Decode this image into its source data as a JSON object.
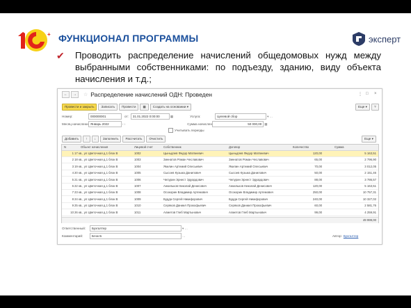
{
  "slide": {
    "title": "ФУНКЦИОНАЛ ПРОГРАММЫ",
    "logo_1c": "1С",
    "expert_brand": "эксперт",
    "bullet": "Проводить распределение начислений общедомовых нужд между выбранными собственниками: по подъезду, зданию, виду объекта начисления и т.д.;",
    "colors": {
      "title": "#1a4f9c",
      "logo_red": "#e2231a",
      "logo_yellow": "#f7d117",
      "check": "#c0242b"
    }
  },
  "window": {
    "title": "Распределение начислений ОДН: Проведен",
    "controls": [
      "⋮",
      "□",
      "×"
    ],
    "toolbar": {
      "post_close": "Провести и закрыть",
      "save": "Записать",
      "post": "Провести",
      "create_based": "Создать на основании",
      "more": "Еще",
      "help": "?"
    },
    "form": {
      "number_label": "Номер:",
      "number_value": "000000001",
      "from_label": "от:",
      "date_value": "31.01.2022 0:00:00",
      "service_label": "Услуга:",
      "service_value": "Целевой сбор",
      "month_label": "Месяц начисления:",
      "month_value": "Январь 2022",
      "amount_label": "Сумма начисления:",
      "amount_value": "50 000,00",
      "consider_periods": "Учитывать периоды"
    },
    "table_toolbar": {
      "add": "Добавить",
      "fill": "Заполнить",
      "distribute": "Рассчитать",
      "clear": "Очистить",
      "more": "Еще"
    },
    "table": {
      "columns": [
        "N",
        "Объект начисления",
        "Лицевой счет",
        "Собственник",
        "Договор",
        "Количество",
        "Сумма"
      ],
      "rows": [
        [
          "1",
          "17 кв., ул Цветочная д.1 блок В",
          "1002",
          "Цыньдяев Федор Матвеевич",
          "Цыньдяев Федор Матвеевич",
          "120,00",
          "5 163,51"
        ],
        [
          "2",
          "18 кв., ул Цветочная д.1 блок В",
          "1003",
          "Зиннатов Роман Чеславович",
          "Зиннатов Роман Чеславович",
          "65,00",
          "2 796,90"
        ],
        [
          "3",
          "19 кв., ул Цветочная д.1 блок В",
          "1004",
          "Якилин Артемий Олесьевич",
          "Якилин Артемий Олесьевич",
          "70,00",
          "3 012,05"
        ],
        [
          "4",
          "20 кв., ул Цветочная д.1 блок В",
          "1005",
          "Сысоев Кузьма Данилович",
          "Сысоев Кузьма Данилович",
          "50,00",
          "2 151,46"
        ],
        [
          "5",
          "21 кв., ул Цветочная д.1 блок В",
          "1006",
          "Чепурин Эрнест Эдуардович",
          "Чепурин Эрнест Эдуардович",
          "88,00",
          "3 786,57"
        ],
        [
          "6",
          "22 кв., ул Цветочная д.1 блок В",
          "1007",
          "Анкильков Николай Денисович",
          "Анкильков Николай Денисович",
          "120,00",
          "5 163,51"
        ],
        [
          "7",
          "23 кв., ул Цветочная д.1 блок В",
          "1008",
          "Осокорин Владимир Артемович",
          "Осокорин Владимир Артемович",
          "250,00",
          "10 757,31"
        ],
        [
          "8",
          "24 кв., ул Цветочная д.1 блок В",
          "1009",
          "Будда Сергей Никифорович",
          "Будда Сергей Никифорович",
          "240,00",
          "10 327,02"
        ],
        [
          "9",
          "25 кв., ул Цветочная д.1 блок В",
          "1010",
          "Серяков Даниил Прокофьевич",
          "Серяков Даниил Прокофьевич",
          "60,00",
          "2 581,76"
        ],
        [
          "10",
          "26 кв., ул Цветочная д.1 блок В",
          "1011",
          "Алметов Глеб Мартынович",
          "Алметов Глеб Мартынович",
          "99,00",
          "4 259,91"
        ]
      ],
      "total": "49 999,00"
    },
    "footer": {
      "responsible_label": "Ответственный:",
      "responsible_value": "Бухгалтер",
      "comment_label": "Комментарий:",
      "comment_value": "Блок Б",
      "author_label": "Автор:",
      "author_value": "Бухгалтер"
    }
  }
}
